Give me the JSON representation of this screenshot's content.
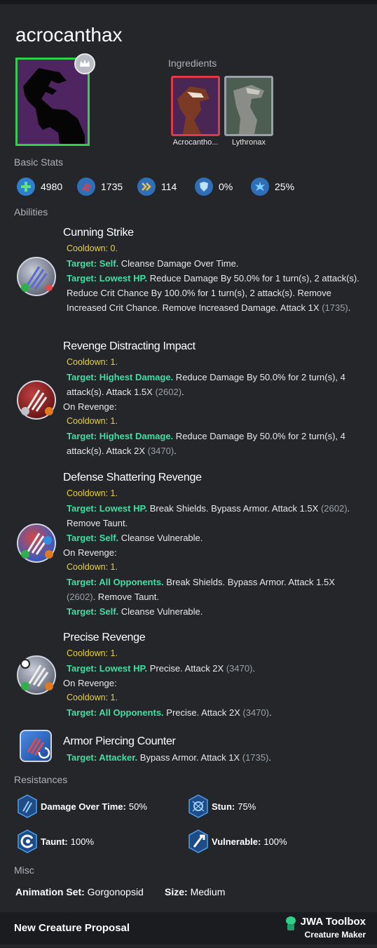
{
  "creature": {
    "name": "acrocanthax"
  },
  "ingredients": {
    "label": "Ingredients",
    "items": [
      {
        "name": "Acrocantho...",
        "rarity_color": "#e03a4a"
      },
      {
        "name": "Lythronax",
        "rarity_color": "#9aa0a8"
      }
    ]
  },
  "basic_stats": {
    "label": "Basic Stats",
    "health": "4980",
    "damage": "1735",
    "speed": "114",
    "armor": "0%",
    "crit": "25%"
  },
  "abilities": {
    "label": "Abilities",
    "a1": {
      "name": "Cunning Strike",
      "cooldown": "Cooldown: 0.",
      "t1": "Target: Self.",
      "d1": " Cleanse Damage Over Time.",
      "t2": "Target: Lowest HP.",
      "d2": " Reduce Damage By 50.0% for 1 turn(s), 2 attack(s). Reduce Crit Chance By 100.0% for 1 turn(s), 2 attack(s). Remove Increased Crit Chance. Remove Increased Damage. Attack 1X ",
      "v2": "(1735)",
      "e2": "."
    },
    "a2": {
      "name": "Revenge Distracting Impact",
      "cooldown": "Cooldown: 1.",
      "t1": "Target: Highest Damage.",
      "d1": " Reduce Damage By 50.0% for 2 turn(s), 4 attack(s). Attack 1.5X ",
      "v1": "(2602)",
      "e1": ".",
      "on_revenge": "On Revenge:",
      "r_cooldown": "Cooldown: 1.",
      "rt1": "Target: Highest Damage.",
      "rd1": " Reduce Damage By 50.0% for 2 turn(s), 4 attack(s). Attack 2X ",
      "rv1": "(3470)",
      "re1": "."
    },
    "a3": {
      "name": "Defense Shattering Revenge",
      "cooldown": "Cooldown: 1.",
      "t1": "Target: Lowest HP.",
      "d1": " Break Shields. Bypass Armor. Attack 1.5X ",
      "v1": "(2602)",
      "e1": ". Remove Taunt.",
      "t2": "Target: Self.",
      "d2": " Cleanse Vulnerable.",
      "on_revenge": "On Revenge:",
      "r_cooldown": "Cooldown: 1.",
      "rt1": "Target: All Opponents.",
      "rd1": " Break Shields. Bypass Armor. Attack 1.5X ",
      "rv1": "(2602)",
      "re1": ". Remove Taunt.",
      "rt2": "Target: Self.",
      "rd2": " Cleanse Vulnerable."
    },
    "a4": {
      "name": "Precise Revenge",
      "cooldown": "Cooldown: 1.",
      "t1": "Target: Lowest HP.",
      "d1": " Precise. Attack 2X ",
      "v1": "(3470)",
      "e1": ".",
      "on_revenge": "On Revenge:",
      "r_cooldown": "Cooldown: 1.",
      "rt1": "Target: All Opponents.",
      "rd1": " Precise. Attack 2X ",
      "rv1": "(3470)",
      "re1": "."
    },
    "a5": {
      "name": "Armor Piercing Counter",
      "t1": "Target: Attacker.",
      "d1": " Bypass Armor. Attack 1X ",
      "v1": "(1735)",
      "e1": "."
    }
  },
  "resistances": {
    "label": "Resistances",
    "dot_label": "Damage Over Time:",
    "dot_value": " 50%",
    "stun_label": "Stun:",
    "stun_value": " 75%",
    "taunt_label": "Taunt:",
    "taunt_value": " 100%",
    "vuln_label": "Vulnerable:",
    "vuln_value": " 100%"
  },
  "misc": {
    "label": "Misc",
    "anim_label": "Animation Set:",
    "anim_value": " Gorgonopsid",
    "size_label": "Size:",
    "size_value": " Medium"
  },
  "footer": {
    "title": "New Creature Proposal",
    "brand": "JWA Toolbox",
    "sub": "Creature Maker"
  },
  "colors": {
    "target": "#3fe0a2",
    "cooldown": "#e8d23a",
    "rarity_unique": "#2fd14a"
  }
}
